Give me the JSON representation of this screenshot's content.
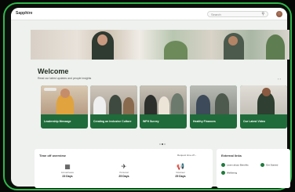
{
  "app": {
    "logo_text": "Sapphire"
  },
  "search": {
    "placeholder": "Search",
    "icon": "search-icon"
  },
  "welcome": {
    "title": "Welcome",
    "subtitle": "Read our latest updates and people insights"
  },
  "carousel": {
    "cards": [
      {
        "label": "Leadership Message"
      },
      {
        "label": "Creating an Inclusive Culture"
      },
      {
        "label": "WFH Survey"
      },
      {
        "label": "Healthy Finances"
      },
      {
        "label": "Our Latest Video"
      }
    ],
    "nav": "‹ ›",
    "active_dot": 1,
    "dot_count": 3
  },
  "time_off": {
    "title": "Time off overview",
    "link": "Request time off ›",
    "stats": [
      {
        "icon": "calendar-icon",
        "label": "Annual leave",
        "value": "23 Days"
      },
      {
        "icon": "plane-icon",
        "label": "Personal",
        "value": "25 Days"
      },
      {
        "icon": "megaphone-icon",
        "label": "Volunteer",
        "value": "25 Days"
      }
    ]
  },
  "external": {
    "title": "External links",
    "links": [
      {
        "label": "Learn about Benefits"
      },
      {
        "label": "Get Started"
      },
      {
        "label": "Wellbeing"
      }
    ]
  },
  "colors": {
    "accent": "#2fb84a",
    "card": "#1f6b3a",
    "screen_bg": "#eef1ee"
  }
}
